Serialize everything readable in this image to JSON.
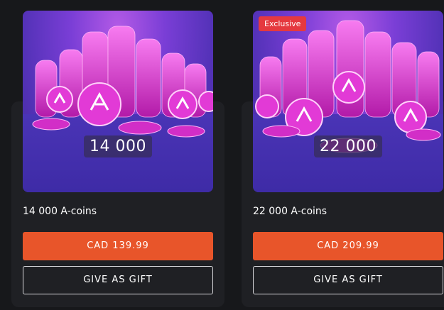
{
  "products": [
    {
      "amount_label": "14 000",
      "title": "14 000 A-coins",
      "price_label": "CAD 139.99",
      "gift_label": "GIVE AS GIFT",
      "exclusive_label": null
    },
    {
      "amount_label": "22 000",
      "title": "22 000 A-coins",
      "price_label": "CAD 209.99",
      "gift_label": "GIVE AS GIFT",
      "exclusive_label": "Exclusive"
    }
  ],
  "colors": {
    "page_bg": "#17181b",
    "card_bg": "#1f2024",
    "buy_button": "#e8552a",
    "exclusive_tag": "#e5393f",
    "coin_pink": "#e23ad6"
  },
  "icons": {
    "coin": "a-coin-icon"
  }
}
